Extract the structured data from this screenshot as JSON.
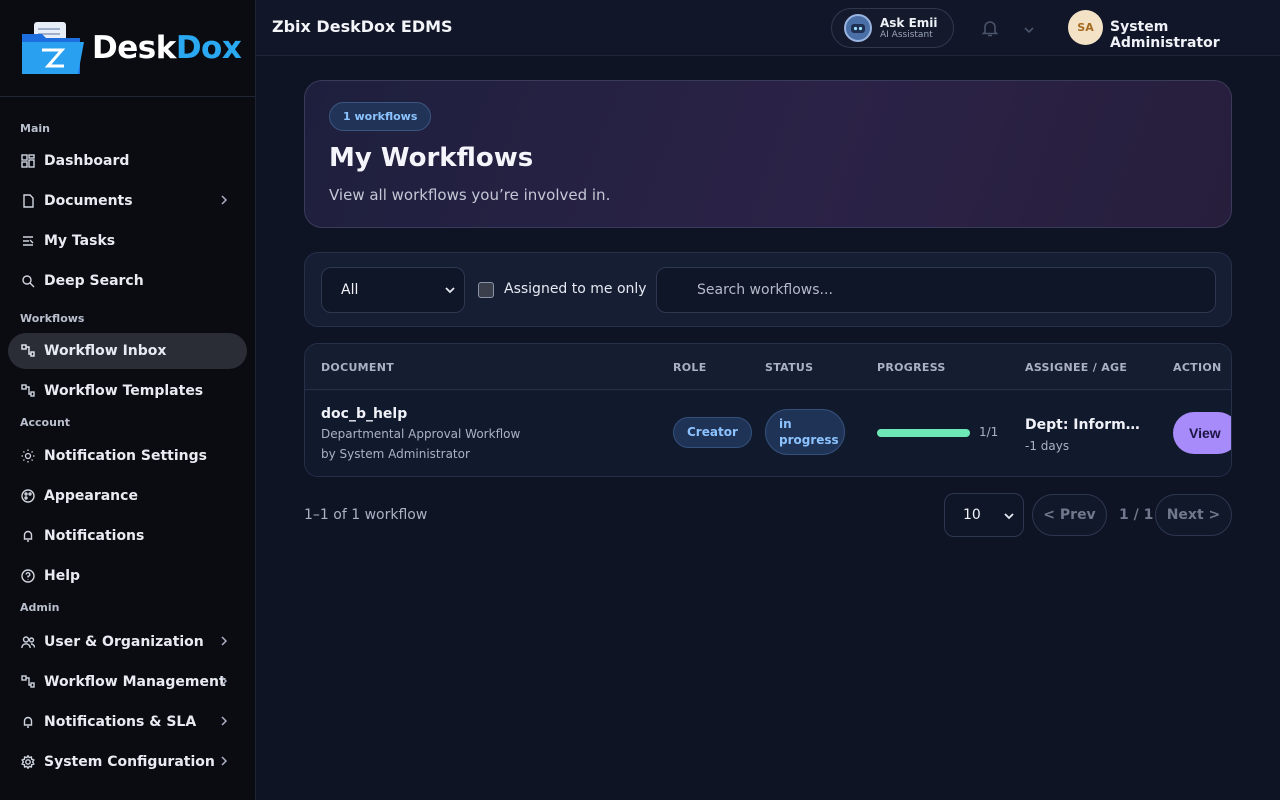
{
  "brand": {
    "logo_part1": "Desk",
    "logo_part2": "Dox"
  },
  "sidebar": {
    "sections": [
      "Main",
      "Workflows",
      "Account",
      "Admin"
    ],
    "main_items": [
      {
        "label": "Dashboard",
        "icon": "dashboard-icon"
      },
      {
        "label": "Documents",
        "icon": "document-icon",
        "has_chevron": true
      },
      {
        "label": "My Tasks",
        "icon": "tasks-icon"
      },
      {
        "label": "Deep Search",
        "icon": "search-icon"
      }
    ],
    "workflow_items": [
      {
        "label": "Workflow Inbox",
        "icon": "workflow-icon",
        "active": true
      },
      {
        "label": "Workflow Templates",
        "icon": "workflow-icon"
      }
    ],
    "account_items": [
      {
        "label": "Notification Settings",
        "icon": "sun-icon"
      },
      {
        "label": "Appearance",
        "icon": "palette-icon"
      },
      {
        "label": "Notifications",
        "icon": "bell-icon"
      },
      {
        "label": "Help",
        "icon": "help-icon"
      }
    ],
    "admin_items": [
      {
        "label": "User & Organization",
        "icon": "users-icon",
        "has_chevron": true
      },
      {
        "label": "Workflow Management",
        "icon": "workflow-icon",
        "has_chevron": true
      },
      {
        "label": "Notifications & SLA",
        "icon": "bell-icon",
        "has_chevron": true
      },
      {
        "label": "System Configuration",
        "icon": "gear-icon",
        "has_chevron": true
      }
    ]
  },
  "header": {
    "title": "Zbix DeskDox EDMS",
    "ask_title": "Ask Emii",
    "ask_subtitle": "AI Assistant",
    "avatar_initials": "SA",
    "user_name": "System Administrator"
  },
  "hero": {
    "count_badge": "1 workflows",
    "title": "My Workflows",
    "subtitle": "View all workflows you’re involved in."
  },
  "filters": {
    "selected": "All",
    "checkbox_label": "Assigned to me only",
    "search_placeholder": "Search workflows..."
  },
  "table": {
    "columns": [
      "DOCUMENT",
      "ROLE",
      "STATUS",
      "PROGRESS",
      "ASSIGNEE / AGE",
      "ACTION"
    ],
    "rows": [
      {
        "document": "doc_b_help",
        "workflow": "Departmental Approval Workflow",
        "by": "by System Administrator",
        "role": "Creator",
        "status_line1": "in",
        "status_line2": "progress",
        "progress_fraction": 1.0,
        "progress_text": "1/1",
        "assignee": "Dept: Informati...",
        "age": "-1 days",
        "action": "View"
      }
    ]
  },
  "footer": {
    "count_text": "1–1 of 1 workflow",
    "per_page": "10",
    "prev": "< Prev",
    "page_info": "1 / 1",
    "next": "Next >"
  },
  "colors": {
    "accent_blue": "#2aa9f2",
    "pill_text": "#8cc3ff",
    "progress_green": "#6ee7b7",
    "view_button": "#a78bfa"
  }
}
